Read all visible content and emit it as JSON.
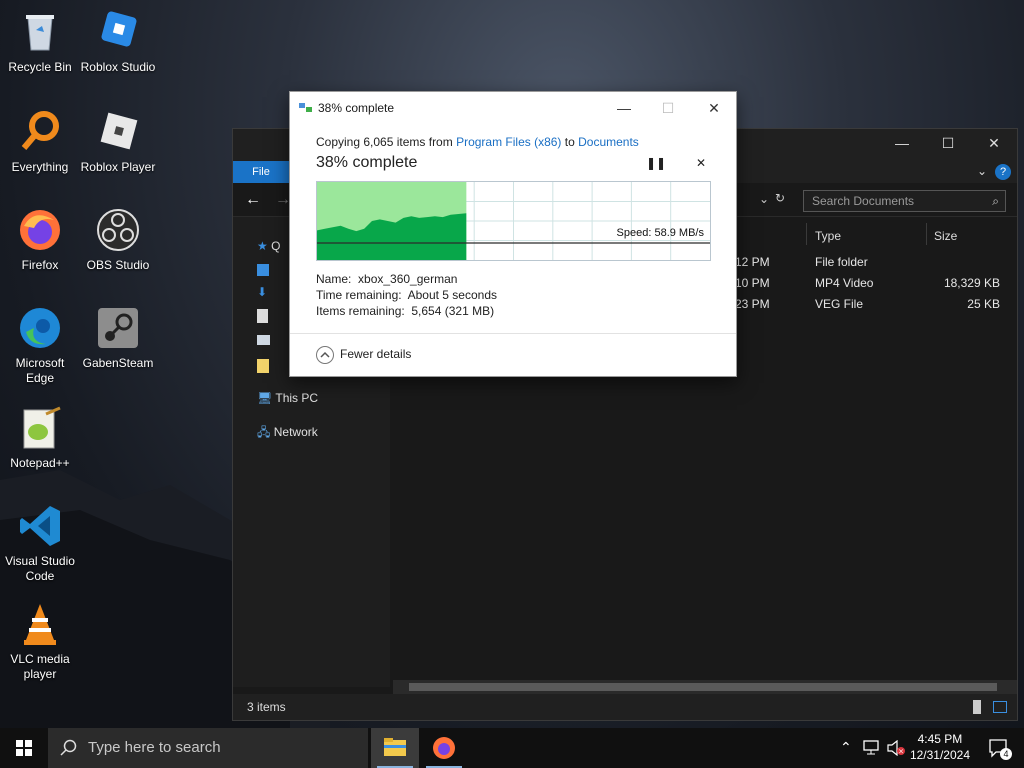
{
  "desktop_icons": [
    {
      "label": "Recycle Bin",
      "icon": "recycle-bin-icon"
    },
    {
      "label": "Roblox Studio",
      "icon": "roblox-studio-icon"
    },
    {
      "label": "Everything",
      "icon": "everything-search-icon"
    },
    {
      "label": "Roblox Player",
      "icon": "roblox-player-icon"
    },
    {
      "label": "Firefox",
      "icon": "firefox-icon"
    },
    {
      "label": "OBS Studio",
      "icon": "obs-studio-icon"
    },
    {
      "label": "Microsoft Edge",
      "icon": "edge-icon"
    },
    {
      "label": "GabenSteam",
      "icon": "steam-icon"
    },
    {
      "label": "Notepad++",
      "icon": "notepad-plus-plus-icon"
    },
    {
      "label": "Visual Studio Code",
      "icon": "vscode-icon"
    },
    {
      "label": "VLC media player",
      "icon": "vlc-icon"
    }
  ],
  "explorer": {
    "file_tab": "File",
    "search_placeholder": "Search Documents",
    "sidebar": {
      "quick_access_fragment": "Q",
      "this_pc": "This PC",
      "network": "Network"
    },
    "columns": {
      "type": "Type",
      "size": "Size"
    },
    "rows": [
      {
        "date_fragment": "12 PM",
        "type": "File folder",
        "size": ""
      },
      {
        "date_fragment": "10 PM",
        "type": "MP4 Video",
        "size": "18,329 KB"
      },
      {
        "date_fragment": "23 PM",
        "type": "VEG File",
        "size": "25 KB"
      }
    ],
    "status": "3 items"
  },
  "dialog": {
    "title": "38% complete",
    "copy_prefix": "Copying 6,065 items from ",
    "source": "Program Files (x86)",
    "to": " to ",
    "destination": "Documents",
    "percent_text": "38% complete",
    "progress_fraction": 0.38,
    "speed": "Speed: 58.9 MB/s",
    "name_label": "Name:",
    "name_value": "xbox_360_german",
    "time_label": "Time remaining:",
    "time_value": "About 5 seconds",
    "items_label": "Items remaining:",
    "items_value": "5,654 (321 MB)",
    "fewer_details": "Fewer details"
  },
  "taskbar": {
    "search_placeholder": "Type here to search",
    "time": "4:45 PM",
    "date": "12/31/2024",
    "notification_count": "4"
  }
}
